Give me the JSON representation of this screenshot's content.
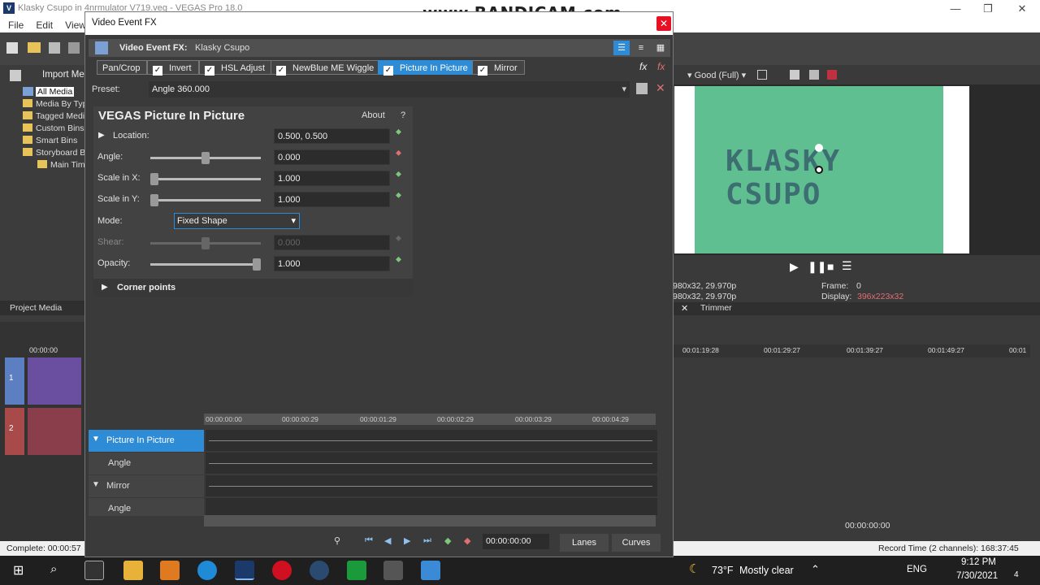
{
  "main_window": {
    "app_title": "Klasky Csupo in 4nrmulator V719.veg - VEGAS Pro 18.0",
    "logo": "V",
    "menu": [
      "File",
      "Edit",
      "View"
    ],
    "watermark": "www.BANDICAM.com",
    "min": "—",
    "max": "❐",
    "close": "✕"
  },
  "left_panel": {
    "import_label": "Import Me",
    "tree": [
      "All Media",
      "Media By Typ",
      "Tagged Medi",
      "Custom Bins",
      "Smart Bins",
      "Storyboard B",
      "Main Timel"
    ],
    "project_media_tab": "Project Media",
    "timeline_time": "00:00:00",
    "track1_number": "1",
    "track2_number": "2"
  },
  "preview": {
    "quality": "Good (Full)",
    "info_line1": "980x32, 29.970p",
    "info_line2": "980x32, 29.970p",
    "frame_label": "Frame:",
    "frame_value": "0",
    "display_label": "Display:",
    "display_value": "396x223x32",
    "trimmer_tab": "Trimmer",
    "logo_text": "KLASKY CSUPO",
    "ruler_ticks": [
      "00:01:19:28",
      "00:01:29:27",
      "00:01:39:27",
      "00:01:49:27",
      "00:01"
    ],
    "bottom_time": "00:00:00:00"
  },
  "fx_dialog": {
    "title": "Video Event FX",
    "close_symbol": "✕",
    "header_label": "Video Event FX:",
    "header_value": "Klasky Csupo",
    "chain": [
      {
        "label": "Pan/Crop",
        "checked": false
      },
      {
        "label": "Invert",
        "checked": true
      },
      {
        "label": "HSL Adjust",
        "checked": true
      },
      {
        "label": "NewBlue ME Wiggle",
        "checked": true
      },
      {
        "label": "Picture In Picture",
        "checked": true
      },
      {
        "label": "Mirror",
        "checked": true
      }
    ],
    "preset_label": "Preset:",
    "preset_value": "Angle 360.000",
    "plugin": {
      "title": "VEGAS Picture In Picture",
      "about": "About",
      "help": "?",
      "params": [
        {
          "label": "Location:",
          "value": "0.500, 0.500"
        },
        {
          "label": "Angle:",
          "value": "0.000",
          "level": 0.5
        },
        {
          "label": "Scale in X:",
          "value": "1.000",
          "level": 0.0
        },
        {
          "label": "Scale in Y:",
          "value": "1.000",
          "level": 0.0
        },
        {
          "label": "Mode:",
          "value": "Fixed Shape"
        },
        {
          "label": "Shear:",
          "value": "0.000",
          "level": 0.5
        },
        {
          "label": "Opacity:",
          "value": "1.000",
          "level": 1.0
        }
      ],
      "corner_points": "Corner points"
    },
    "keyframes": {
      "ruler": [
        "00:00:00:00",
        "00:00:00:29",
        "00:00:01:29",
        "00:00:02:29",
        "00:00:03:29",
        "00:00:04:29"
      ],
      "tracks": [
        {
          "label": "Picture In Picture",
          "selected": true,
          "group": true
        },
        {
          "label": "Angle",
          "selected": false,
          "group": false
        },
        {
          "label": "Mirror",
          "selected": false,
          "group": true
        },
        {
          "label": "Angle",
          "selected": false,
          "group": false
        }
      ],
      "time": "00:00:00:00",
      "lanes_tab": "Lanes",
      "curves_tab": "Curves"
    }
  },
  "status": {
    "left": "Complete: 00:00:57",
    "right": "Record Time (2 channels): 168:37:45"
  },
  "taskbar": {
    "weather_temp": "73°F",
    "weather_text": "Mostly clear",
    "language": "ENG",
    "time": "9:12 PM",
    "date": "7/30/2021",
    "notifications": "4"
  },
  "colors": {
    "accent": "#2e8bd6",
    "dialog_bg": "#3a3a3a",
    "preview_green": "#5fbf91"
  }
}
